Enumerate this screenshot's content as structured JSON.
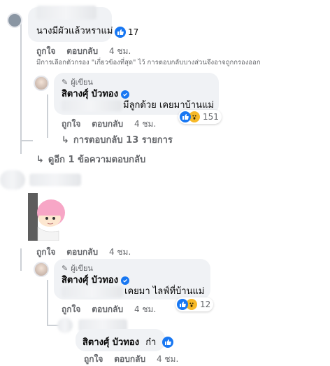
{
  "colors": {
    "like": "#1877f2",
    "wow": "#f7b928",
    "meta": "#65676b",
    "bubble": "#f0f2f5"
  },
  "c1": {
    "text": "นางมีผัวแล้วหราแม่",
    "react_count": "17",
    "like": "ถูกใจ",
    "reply": "ตอบกลับ",
    "time": "4 ชม."
  },
  "filter_note": "มีการเลือกตัวกรอง \"เกี่ยวข้องที่สุด\" ไว้ การตอบกลับบางส่วนจึงอาจถูกกรองออก",
  "r1": {
    "author_tag": "ผู้เขียน",
    "name": "สิตางศุ์ บัวทอง",
    "text": "มีลูกด้วย เคยมาบ้านแม่",
    "react_count": "151",
    "like": "ถูกใจ",
    "reply": "ตอบกลับ",
    "time": "4 ชม."
  },
  "more_replies": "การตอบกลับ 13 รายการ",
  "see_more": "ดูอีก 1 ข้อความตอบกลับ",
  "c2": {
    "like": "ถูกใจ",
    "reply": "ตอบกลับ",
    "time": "4 ชม."
  },
  "r2": {
    "author_tag": "ผู้เขียน",
    "name": "สิตางศุ์ บัวทอง",
    "text": "เคยมา ไลฟ์ที่บ้านแม่",
    "react_count": "12",
    "like": "ถูกใจ",
    "reply": "ตอบกลับ",
    "time": "4 ชม."
  },
  "r3": {
    "name": "สิตางศุ์ บัวทอง",
    "text": "ก๋า",
    "like": "ถูกใจ",
    "reply": "ตอบกลับ",
    "time": "4 ชม."
  }
}
